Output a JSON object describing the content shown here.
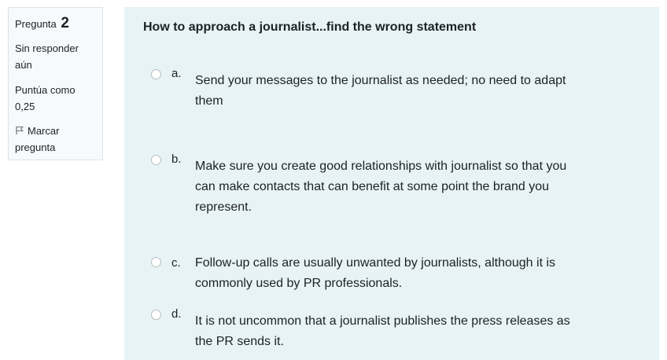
{
  "info": {
    "question_label": "Pregunta",
    "question_number": "2",
    "state_line1": "Sin responder",
    "state_line2": "aún",
    "grade_line1": "Puntúa como",
    "grade_line2": "0,25",
    "flag_line1": "Marcar",
    "flag_line2": "pregunta",
    "flag_icon": "flag-icon"
  },
  "question": {
    "text": "How to approach a journalist...find the wrong statement",
    "options": [
      {
        "letter": "a.",
        "line1": "Send your messages to the journalist as needed; no need to adapt",
        "line2": "them",
        "line3": ""
      },
      {
        "letter": "b.",
        "line1": "Make sure you create good relationships with journalist so that you",
        "line2": "can make contacts that can benefit at some point the brand you",
        "line3": "represent."
      },
      {
        "letter": "c.",
        "line1": "Follow-up calls are usually unwanted by journalists, although it is",
        "line2": "commonly used by PR professionals.",
        "line3": ""
      },
      {
        "letter": "d.",
        "line1": "It is not uncommon that a journalist publishes the press releases as",
        "line2": "the PR sends it.",
        "line3": ""
      }
    ]
  },
  "colors": {
    "content_bg": "#e7f3f5",
    "info_bg": "#f8f9fa",
    "info_border": "#dee2e6",
    "text": "#1d2125"
  }
}
